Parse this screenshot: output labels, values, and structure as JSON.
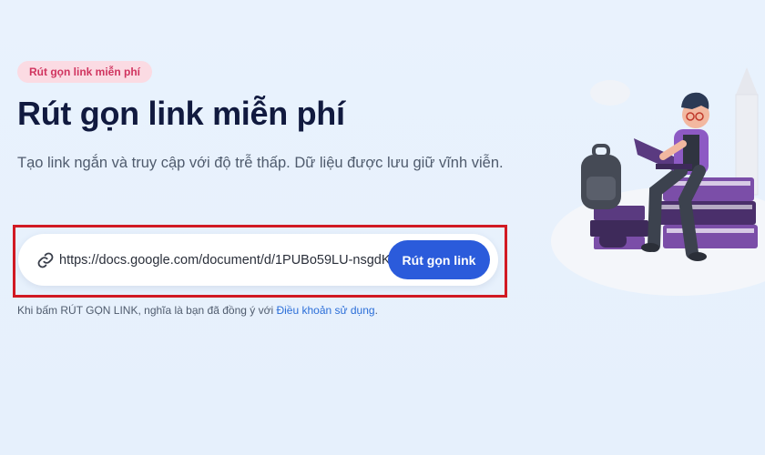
{
  "badge": {
    "label": "Rút gọn link miễn phí"
  },
  "hero": {
    "title": "Rút gọn link miễn phí",
    "subtitle": "Tạo link ngắn và truy cập với độ trễ thấp. Dữ liệu được lưu giữ vĩnh viễn."
  },
  "shortener": {
    "url_value": "https://docs.google.com/document/d/1PUBo59LU-nsgdK",
    "button_label": "Rút gọn link",
    "icon": "link-icon"
  },
  "terms": {
    "prefix": "Khi bấm RÚT GỌN LINK, nghĩa là bạn đã đồng ý với",
    "link_label": "Điều khoản sử dụng",
    "suffix": "."
  },
  "colors": {
    "accent": "#2b5bdb",
    "title": "#111a3f",
    "badge_bg": "#fbdbe3",
    "badge_text": "#d0345f",
    "highlight": "#d11a23"
  }
}
